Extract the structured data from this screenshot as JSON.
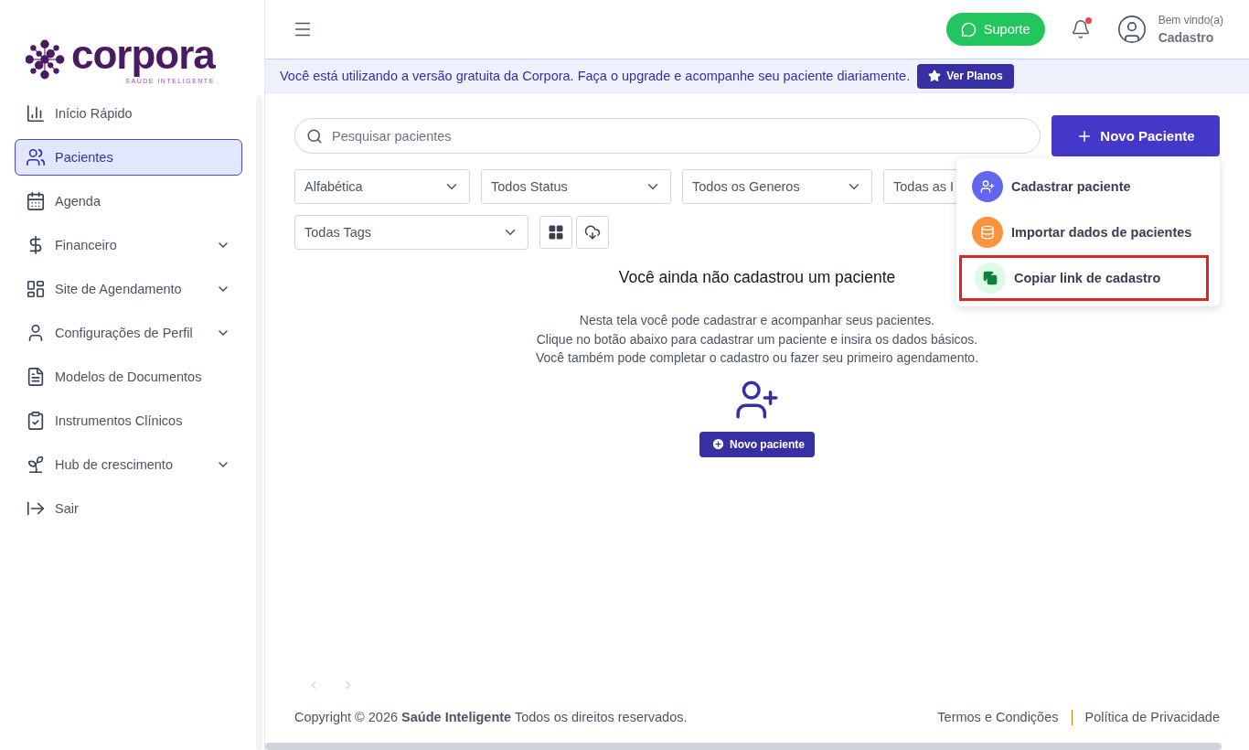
{
  "logo": {
    "name": "corpora",
    "tagline": "SAÚDE INTELIGENTE"
  },
  "sidebar": {
    "items": [
      {
        "label": "Início Rápido",
        "kind": "link",
        "selected": false
      },
      {
        "label": "Pacientes",
        "kind": "link",
        "selected": true
      },
      {
        "label": "Agenda",
        "kind": "link",
        "selected": false
      },
      {
        "label": "Financeiro",
        "kind": "group",
        "selected": false
      },
      {
        "label": "Site de Agendamento",
        "kind": "group",
        "selected": false
      },
      {
        "label": "Configurações de Perfil",
        "kind": "group",
        "selected": false
      },
      {
        "label": "Modelos de Documentos",
        "kind": "link",
        "selected": false
      },
      {
        "label": "Instrumentos Clínicos",
        "kind": "link",
        "selected": false
      },
      {
        "label": "Hub de crescimento",
        "kind": "group",
        "selected": false
      },
      {
        "label": "Sair",
        "kind": "link",
        "selected": false
      }
    ]
  },
  "topbar": {
    "support_button": "Suporte",
    "notifications": {
      "unread": true
    },
    "user": {
      "greeting": "Bem vindo(a)",
      "name": "Cadastro"
    }
  },
  "banner": {
    "text": "Você está utilizando a versão gratuita da Corpora. Faça o upgrade e acompanhe seu paciente diariamente.",
    "button": "Ver Planos"
  },
  "search": {
    "placeholder": "Pesquisar pacientes"
  },
  "new_patient_button": "Novo Paciente",
  "filters": [
    {
      "value": "Alfabética",
      "kind": "full"
    },
    {
      "value": "Todos Status",
      "kind": "full"
    },
    {
      "value": "Todos os Generos",
      "kind": "full"
    },
    {
      "value": "Todas as I",
      "kind": "covered"
    }
  ],
  "tags_filter": {
    "value": "Todas Tags"
  },
  "new_patient_menu": {
    "items": [
      {
        "label": "Cadastrar paciente",
        "color": "#6366f1",
        "highlighted": false
      },
      {
        "label": "Importar dados de pacientes",
        "color": "#fb923c",
        "highlighted": false
      },
      {
        "label": "Copiar link de cadastro",
        "color": "#dcfce7",
        "highlighted": true
      }
    ]
  },
  "empty_state": {
    "title": "Você ainda não cadastrou um paciente",
    "lines": [
      "Nesta tela você pode cadastrar e acompanhar seus pacientes.",
      "Clique no botão abaixo para cadastrar um paciente e insira os dados básicos.",
      "Você também pode completar o cadastro ou fazer seu primeiro agendamento."
    ],
    "button": "Novo paciente"
  },
  "footer": {
    "copyright": "Copyright © 2026 **Saúde Inteligente** Todos os direitos reservados.",
    "links": [
      "Termos e Condições",
      "Política de Privacidade"
    ]
  }
}
